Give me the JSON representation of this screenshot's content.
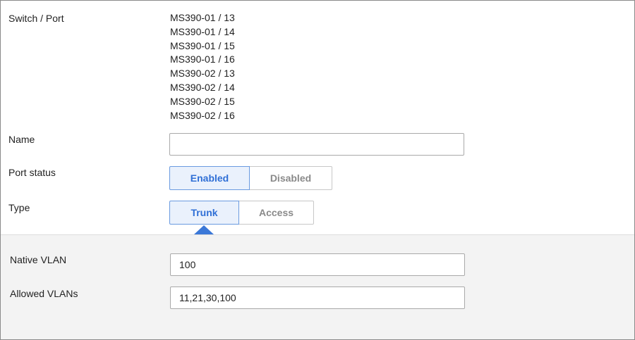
{
  "form": {
    "switch_port": {
      "label": "Switch / Port",
      "ports": [
        "MS390-01 / 13",
        "MS390-01 / 14",
        "MS390-01 / 15",
        "MS390-01 / 16",
        "MS390-02 / 13",
        "MS390-02 / 14",
        "MS390-02 / 15",
        "MS390-02 / 16"
      ]
    },
    "name": {
      "label": "Name",
      "value": "",
      "placeholder": ""
    },
    "port_status": {
      "label": "Port status",
      "options": [
        "Enabled",
        "Disabled"
      ],
      "selected": "Enabled"
    },
    "type": {
      "label": "Type",
      "options": [
        "Trunk",
        "Access"
      ],
      "selected": "Trunk"
    }
  },
  "trunk_settings": {
    "native_vlan": {
      "label": "Native VLAN",
      "value": "100"
    },
    "allowed_vlans": {
      "label": "Allowed VLANs",
      "value": "11,21,30,100"
    }
  },
  "colors": {
    "accent": "#2f6fd6",
    "active_bg": "#eaf1fc",
    "panel_bg": "#f3f3f3",
    "inactive_text": "#8a8a8a"
  }
}
